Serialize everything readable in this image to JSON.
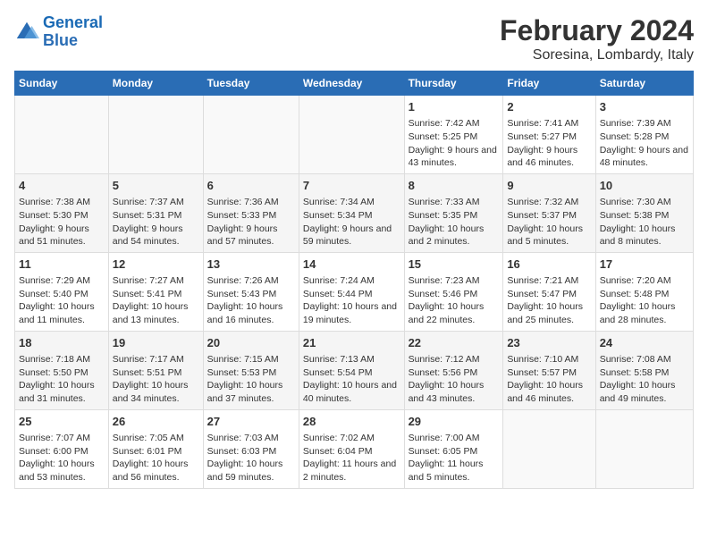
{
  "logo": {
    "line1": "General",
    "line2": "Blue"
  },
  "title": "February 2024",
  "subtitle": "Soresina, Lombardy, Italy",
  "days_of_week": [
    "Sunday",
    "Monday",
    "Tuesday",
    "Wednesday",
    "Thursday",
    "Friday",
    "Saturday"
  ],
  "weeks": [
    [
      {
        "day": "",
        "info": ""
      },
      {
        "day": "",
        "info": ""
      },
      {
        "day": "",
        "info": ""
      },
      {
        "day": "",
        "info": ""
      },
      {
        "day": "1",
        "info": "Sunrise: 7:42 AM\nSunset: 5:25 PM\nDaylight: 9 hours and 43 minutes."
      },
      {
        "day": "2",
        "info": "Sunrise: 7:41 AM\nSunset: 5:27 PM\nDaylight: 9 hours and 46 minutes."
      },
      {
        "day": "3",
        "info": "Sunrise: 7:39 AM\nSunset: 5:28 PM\nDaylight: 9 hours and 48 minutes."
      }
    ],
    [
      {
        "day": "4",
        "info": "Sunrise: 7:38 AM\nSunset: 5:30 PM\nDaylight: 9 hours and 51 minutes."
      },
      {
        "day": "5",
        "info": "Sunrise: 7:37 AM\nSunset: 5:31 PM\nDaylight: 9 hours and 54 minutes."
      },
      {
        "day": "6",
        "info": "Sunrise: 7:36 AM\nSunset: 5:33 PM\nDaylight: 9 hours and 57 minutes."
      },
      {
        "day": "7",
        "info": "Sunrise: 7:34 AM\nSunset: 5:34 PM\nDaylight: 9 hours and 59 minutes."
      },
      {
        "day": "8",
        "info": "Sunrise: 7:33 AM\nSunset: 5:35 PM\nDaylight: 10 hours and 2 minutes."
      },
      {
        "day": "9",
        "info": "Sunrise: 7:32 AM\nSunset: 5:37 PM\nDaylight: 10 hours and 5 minutes."
      },
      {
        "day": "10",
        "info": "Sunrise: 7:30 AM\nSunset: 5:38 PM\nDaylight: 10 hours and 8 minutes."
      }
    ],
    [
      {
        "day": "11",
        "info": "Sunrise: 7:29 AM\nSunset: 5:40 PM\nDaylight: 10 hours and 11 minutes."
      },
      {
        "day": "12",
        "info": "Sunrise: 7:27 AM\nSunset: 5:41 PM\nDaylight: 10 hours and 13 minutes."
      },
      {
        "day": "13",
        "info": "Sunrise: 7:26 AM\nSunset: 5:43 PM\nDaylight: 10 hours and 16 minutes."
      },
      {
        "day": "14",
        "info": "Sunrise: 7:24 AM\nSunset: 5:44 PM\nDaylight: 10 hours and 19 minutes."
      },
      {
        "day": "15",
        "info": "Sunrise: 7:23 AM\nSunset: 5:46 PM\nDaylight: 10 hours and 22 minutes."
      },
      {
        "day": "16",
        "info": "Sunrise: 7:21 AM\nSunset: 5:47 PM\nDaylight: 10 hours and 25 minutes."
      },
      {
        "day": "17",
        "info": "Sunrise: 7:20 AM\nSunset: 5:48 PM\nDaylight: 10 hours and 28 minutes."
      }
    ],
    [
      {
        "day": "18",
        "info": "Sunrise: 7:18 AM\nSunset: 5:50 PM\nDaylight: 10 hours and 31 minutes."
      },
      {
        "day": "19",
        "info": "Sunrise: 7:17 AM\nSunset: 5:51 PM\nDaylight: 10 hours and 34 minutes."
      },
      {
        "day": "20",
        "info": "Sunrise: 7:15 AM\nSunset: 5:53 PM\nDaylight: 10 hours and 37 minutes."
      },
      {
        "day": "21",
        "info": "Sunrise: 7:13 AM\nSunset: 5:54 PM\nDaylight: 10 hours and 40 minutes."
      },
      {
        "day": "22",
        "info": "Sunrise: 7:12 AM\nSunset: 5:56 PM\nDaylight: 10 hours and 43 minutes."
      },
      {
        "day": "23",
        "info": "Sunrise: 7:10 AM\nSunset: 5:57 PM\nDaylight: 10 hours and 46 minutes."
      },
      {
        "day": "24",
        "info": "Sunrise: 7:08 AM\nSunset: 5:58 PM\nDaylight: 10 hours and 49 minutes."
      }
    ],
    [
      {
        "day": "25",
        "info": "Sunrise: 7:07 AM\nSunset: 6:00 PM\nDaylight: 10 hours and 53 minutes."
      },
      {
        "day": "26",
        "info": "Sunrise: 7:05 AM\nSunset: 6:01 PM\nDaylight: 10 hours and 56 minutes."
      },
      {
        "day": "27",
        "info": "Sunrise: 7:03 AM\nSunset: 6:03 PM\nDaylight: 10 hours and 59 minutes."
      },
      {
        "day": "28",
        "info": "Sunrise: 7:02 AM\nSunset: 6:04 PM\nDaylight: 11 hours and 2 minutes."
      },
      {
        "day": "29",
        "info": "Sunrise: 7:00 AM\nSunset: 6:05 PM\nDaylight: 11 hours and 5 minutes."
      },
      {
        "day": "",
        "info": ""
      },
      {
        "day": "",
        "info": ""
      }
    ]
  ]
}
